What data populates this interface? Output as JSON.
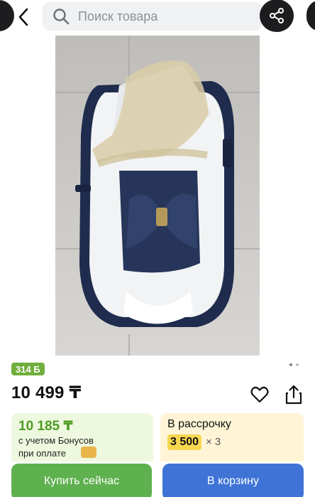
{
  "header": {
    "search_placeholder": "Поиск товара"
  },
  "product": {
    "bonus_badge": "314 Б",
    "price": "10 499 ₸",
    "image_index": 1,
    "image_count": 2
  },
  "offers": {
    "bonus_card": {
      "amount": "10 185 ₸",
      "line1": "с учетом Бонусов",
      "line2": "при оплате"
    },
    "installment_card": {
      "title": "В рассрочку",
      "monthly": "3 500",
      "multiplier": "× 3"
    }
  },
  "actions": {
    "buy_now": "Купить сейчас",
    "add_to_cart": "В корзину"
  },
  "colors": {
    "buy_button": "#5fb14f",
    "cart_button": "#3f74d6",
    "bonus_green": "#4e9d25",
    "installment_yellow": "#f7d650"
  }
}
